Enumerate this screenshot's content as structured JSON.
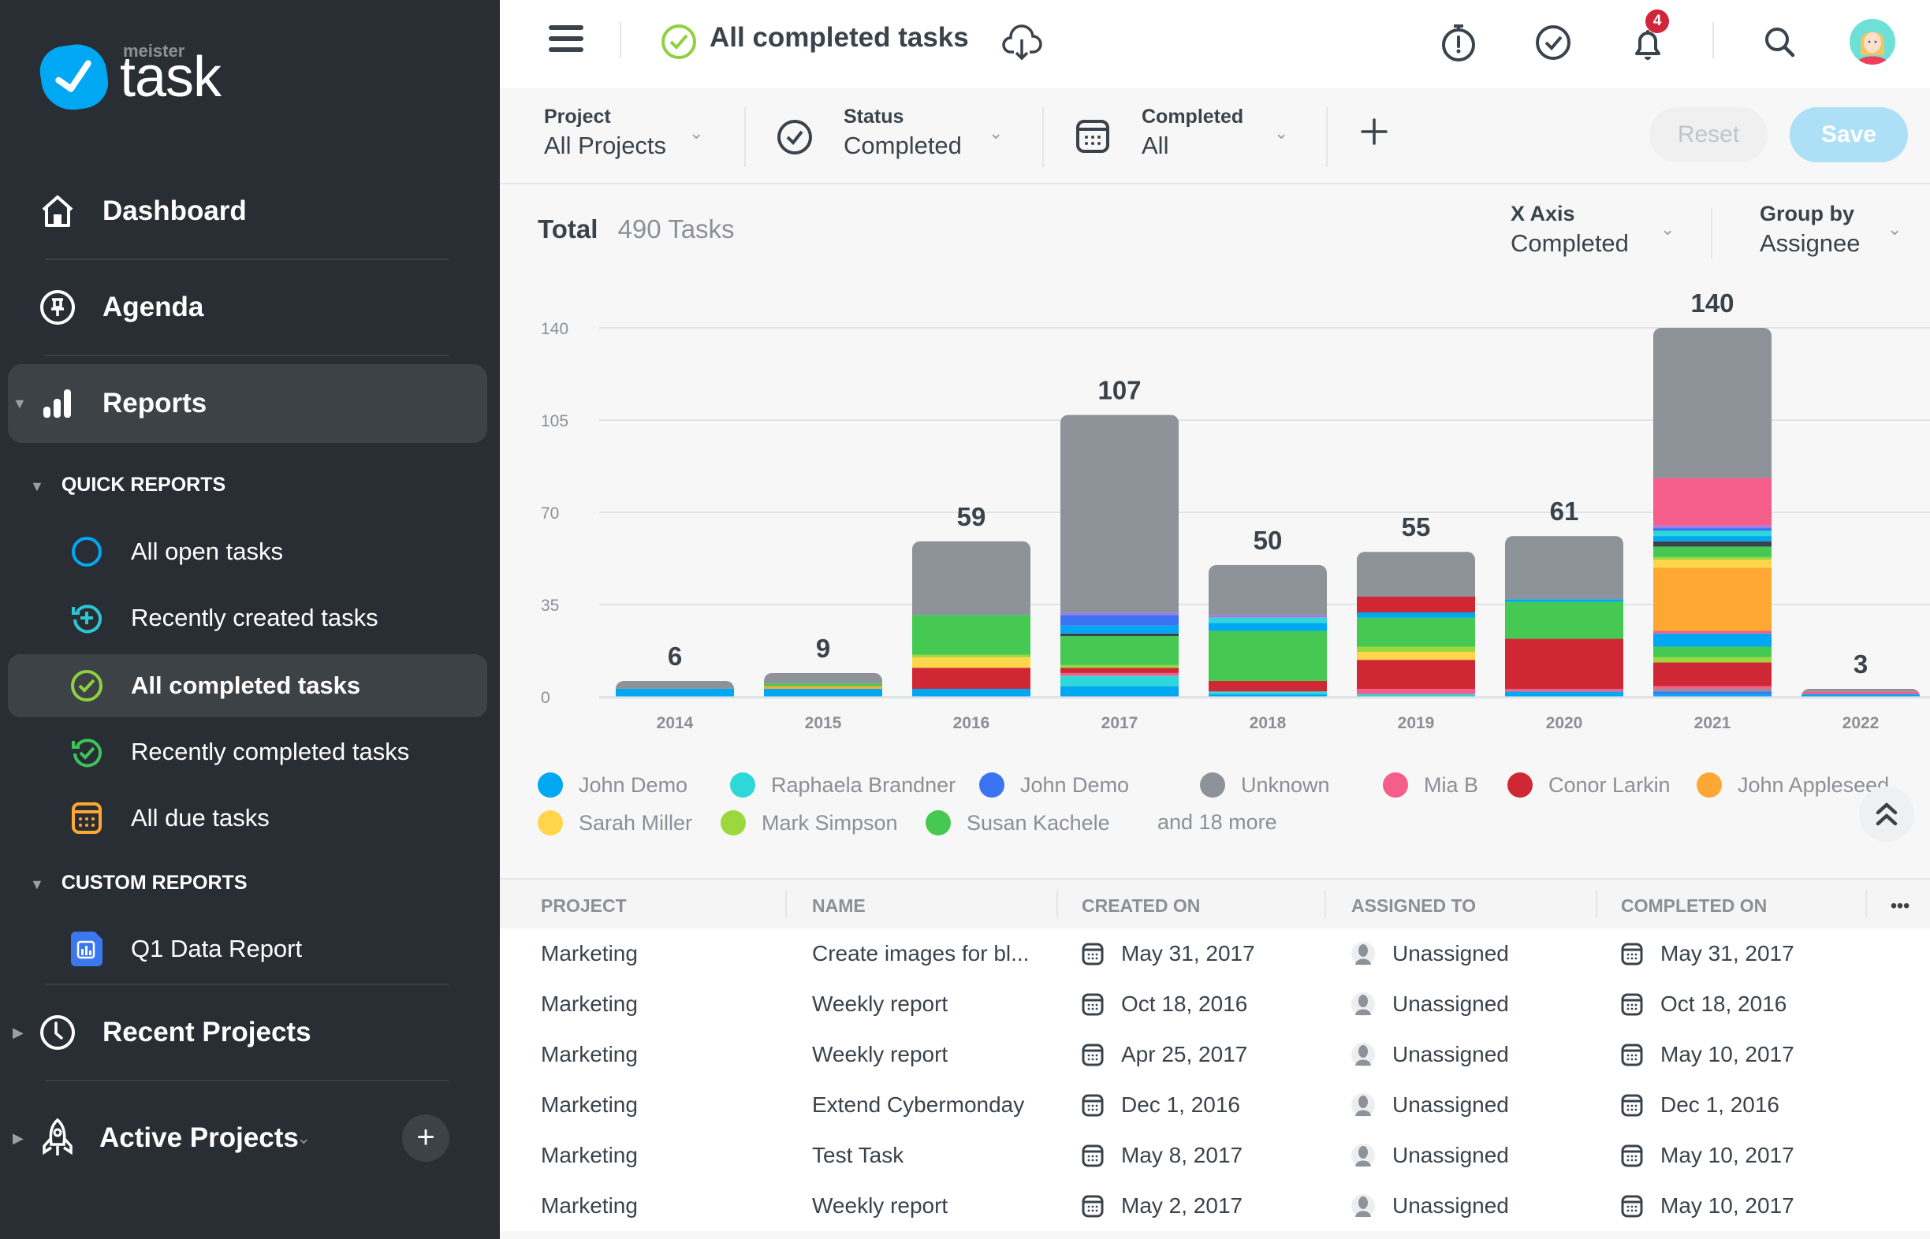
{
  "sidebar": {
    "logo": {
      "small": "meister",
      "big": "task"
    },
    "nav": [
      {
        "label": "Dashboard",
        "icon": "home-icon"
      },
      {
        "label": "Agenda",
        "icon": "pin-icon"
      },
      {
        "label": "Reports",
        "icon": "bar-chart-icon",
        "active": true
      }
    ],
    "quick_reports": {
      "heading": "QUICK REPORTS",
      "items": [
        {
          "label": "All open tasks",
          "icon": "open-circle-icon",
          "color": "#00a8f4"
        },
        {
          "label": "Recently created tasks",
          "icon": "recent-add-icon",
          "color": "#2dc6d6"
        },
        {
          "label": "All completed tasks",
          "icon": "completed-check-icon",
          "color": "#8dd13f",
          "active": true
        },
        {
          "label": "Recently completed tasks",
          "icon": "recent-check-icon",
          "color": "#3cc35a"
        },
        {
          "label": "All due tasks",
          "icon": "calendar-icon",
          "color": "#ffa733"
        }
      ]
    },
    "custom_reports": {
      "heading": "CUSTOM REPORTS",
      "items": [
        {
          "label": "Q1 Data Report",
          "icon": "report-file-icon",
          "color": "#3b78f0"
        }
      ]
    },
    "recent_projects": "Recent Projects",
    "active_projects": "Active Projects"
  },
  "topbar": {
    "title": "All completed tasks",
    "notification_count": "4"
  },
  "filters": {
    "project": {
      "label": "Project",
      "value": "All Projects"
    },
    "status": {
      "label": "Status",
      "value": "Completed"
    },
    "completed": {
      "label": "Completed",
      "value": "All"
    },
    "reset": "Reset",
    "save": "Save"
  },
  "summary": {
    "total_label": "Total",
    "total_value": "490 Tasks",
    "x_axis": {
      "label": "X Axis",
      "value": "Completed"
    },
    "group_by": {
      "label": "Group by",
      "value": "Assignee"
    }
  },
  "chart_data": {
    "type": "bar",
    "stacked": true,
    "title": "",
    "xlabel": "",
    "ylabel": "",
    "ylim": [
      0,
      140
    ],
    "yticks": [
      0,
      35,
      70,
      105,
      140
    ],
    "grid": true,
    "legend_position": "bottom",
    "categories": [
      "2014",
      "2015",
      "2016",
      "2017",
      "2018",
      "2019",
      "2020",
      "2021",
      "2022"
    ],
    "totals": [
      6,
      9,
      59,
      107,
      50,
      55,
      61,
      140,
      3
    ],
    "stacks": [
      [
        [
          "John Demo",
          3
        ],
        [
          "Unknown",
          3
        ]
      ],
      [
        [
          "John Demo",
          3
        ],
        [
          "John Appleseed",
          1
        ],
        [
          "Susan Kachele",
          1
        ],
        [
          "Unknown",
          4
        ]
      ],
      [
        [
          "John Demo",
          3
        ],
        [
          "Conor Larkin",
          8
        ],
        [
          "Sarah Miller",
          4
        ],
        [
          "Mark Simpson",
          1
        ],
        [
          "Susan Kachele",
          15
        ],
        [
          "Unknown",
          28
        ]
      ],
      [
        [
          "John Demo",
          4
        ],
        [
          "Raphaela Brandner",
          4
        ],
        [
          "Mia B",
          1
        ],
        [
          "Conor Larkin",
          2
        ],
        [
          "Mark Simpson",
          1
        ],
        [
          "Susan Kachele",
          11
        ],
        [
          "Other (dark)",
          1
        ],
        [
          "John Demo",
          3
        ],
        [
          "John Demo (blue)",
          4
        ],
        [
          "Other (purple)",
          1
        ],
        [
          "Unknown",
          75
        ]
      ],
      [
        [
          "John Demo",
          1
        ],
        [
          "Raphaela Brandner",
          1
        ],
        [
          "Conor Larkin",
          4
        ],
        [
          "Susan Kachele",
          19
        ],
        [
          "John Demo",
          3
        ],
        [
          "Raphaela Brandner",
          2
        ],
        [
          "Other (purple)",
          1
        ],
        [
          "Unknown",
          19
        ]
      ],
      [
        [
          "Raphaela Brandner",
          1
        ],
        [
          "Mia B",
          2
        ],
        [
          "Conor Larkin",
          11
        ],
        [
          "Sarah Miller",
          3
        ],
        [
          "Mark Simpson",
          2
        ],
        [
          "Susan Kachele",
          11
        ],
        [
          "John Demo",
          2
        ],
        [
          "Conor Larkin",
          6
        ],
        [
          "Unknown",
          17
        ]
      ],
      [
        [
          "John Demo",
          2
        ],
        [
          "Mia B",
          1
        ],
        [
          "Conor Larkin",
          19
        ],
        [
          "Susan Kachele",
          14
        ],
        [
          "John Demo",
          1
        ],
        [
          "Unknown",
          24
        ]
      ],
      [
        [
          "John Demo",
          1
        ],
        [
          "John Demo (blue)",
          1
        ],
        [
          "Unknown",
          1
        ],
        [
          "Mia B",
          1
        ],
        [
          "Conor Larkin",
          9
        ],
        [
          "Mark Simpson",
          2
        ],
        [
          "Susan Kachele",
          4
        ],
        [
          "John Demo",
          5
        ],
        [
          "Mia B",
          1
        ],
        [
          "John Appleseed",
          24
        ],
        [
          "Sarah Miller",
          3
        ],
        [
          "Mark Simpson",
          1
        ],
        [
          "Susan Kachele",
          4
        ],
        [
          "Other (dark)",
          2
        ],
        [
          "John Demo",
          2
        ],
        [
          "Raphaela Brandner",
          2
        ],
        [
          "John Demo (blue)",
          1
        ],
        [
          "Other (purple)",
          1
        ],
        [
          "Mia B",
          18
        ],
        [
          "Unknown",
          57
        ]
      ],
      [
        [
          "John Demo",
          1
        ],
        [
          "Mia B",
          1
        ],
        [
          "Unknown",
          1
        ]
      ]
    ],
    "legend": [
      {
        "name": "John Demo",
        "color": "#00a8f4"
      },
      {
        "name": "Raphaela Brandner",
        "color": "#2ed8d8"
      },
      {
        "name": "John Demo",
        "color": "#3b73f2"
      },
      {
        "name": "Unknown",
        "color": "#8d9398"
      },
      {
        "name": "Mia B",
        "color": "#f55d8a"
      },
      {
        "name": "Conor Larkin",
        "color": "#d02734"
      },
      {
        "name": "John Appleseed",
        "color": "#ffa733"
      },
      {
        "name": "Sarah Miller",
        "color": "#ffd54a"
      },
      {
        "name": "Mark Simpson",
        "color": "#9bd83e"
      },
      {
        "name": "Susan Kachele",
        "color": "#45c952"
      }
    ],
    "legend_more": "and 18 more",
    "series_colors": {
      "John Demo": "#00a8f4",
      "Raphaela Brandner": "#2ed8d8",
      "John Demo (blue)": "#3b73f2",
      "Unknown": "#8d9398",
      "Mia B": "#f55d8a",
      "Conor Larkin": "#d02734",
      "John Appleseed": "#ffa733",
      "Sarah Miller": "#ffd54a",
      "Mark Simpson": "#9bd83e",
      "Susan Kachele": "#45c952",
      "Other (dark)": "#3a434b",
      "Other (purple)": "#9b7fe6"
    }
  },
  "table": {
    "columns": [
      "PROJECT",
      "NAME",
      "CREATED ON",
      "ASSIGNED TO",
      "COMPLETED ON"
    ],
    "more": "•••",
    "rows": [
      {
        "project": "Marketing",
        "name": "Create images for bl...",
        "created": "May 31, 2017",
        "assigned": "Unassigned",
        "completed": "May 31, 2017"
      },
      {
        "project": "Marketing",
        "name": "Weekly report",
        "created": "Oct 18, 2016",
        "assigned": "Unassigned",
        "completed": "Oct 18, 2016"
      },
      {
        "project": "Marketing",
        "name": "Weekly report",
        "created": "Apr 25, 2017",
        "assigned": "Unassigned",
        "completed": "May 10, 2017"
      },
      {
        "project": "Marketing",
        "name": "Extend Cybermonday",
        "created": "Dec 1, 2016",
        "assigned": "Unassigned",
        "completed": "Dec 1, 2016"
      },
      {
        "project": "Marketing",
        "name": "Test Task",
        "created": "May 8, 2017",
        "assigned": "Unassigned",
        "completed": "May 10, 2017"
      },
      {
        "project": "Marketing",
        "name": "Weekly report",
        "created": "May 2, 2017",
        "assigned": "Unassigned",
        "completed": "May 10, 2017"
      }
    ]
  }
}
